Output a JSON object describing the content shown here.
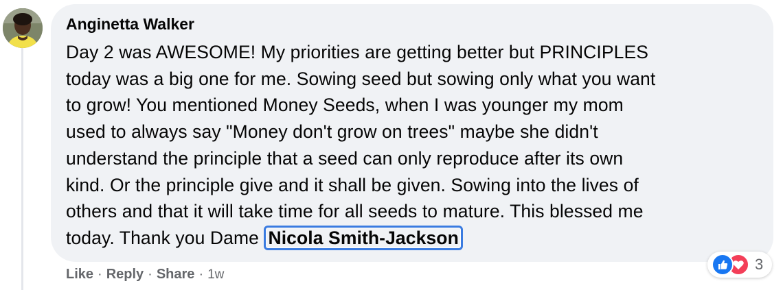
{
  "comment": {
    "author": "Anginetta Walker",
    "body": "Day 2 was AWESOME! My priorities are getting better but PRINCIPLES\ntoday was a big one for me. Sowing seed but sowing only what you want\nto grow! You mentioned Money Seeds, when I was younger my mom\nused to always say \"Money don't grow on trees\" maybe she didn't\nunderstand the principle that a seed can only reproduce after its own\nkind. Or the principle give and it shall be given. Sowing into the lives of\nothers and that it will take time for all seeds to mature. This blessed me\ntoday. Thank you Dame ",
    "mention": "Nicola Smith-Jackson"
  },
  "actions": {
    "like": "Like",
    "reply": "Reply",
    "share": "Share",
    "separator": "·",
    "time": "1w"
  },
  "reactions": {
    "icons": [
      "like-icon",
      "love-icon"
    ],
    "count": "3"
  },
  "colors": {
    "bubble": "#f0f2f5",
    "mention_outline": "#3a7be0",
    "like": "#1877f2",
    "love": "#f33e58",
    "secondary_text": "#65676b"
  }
}
